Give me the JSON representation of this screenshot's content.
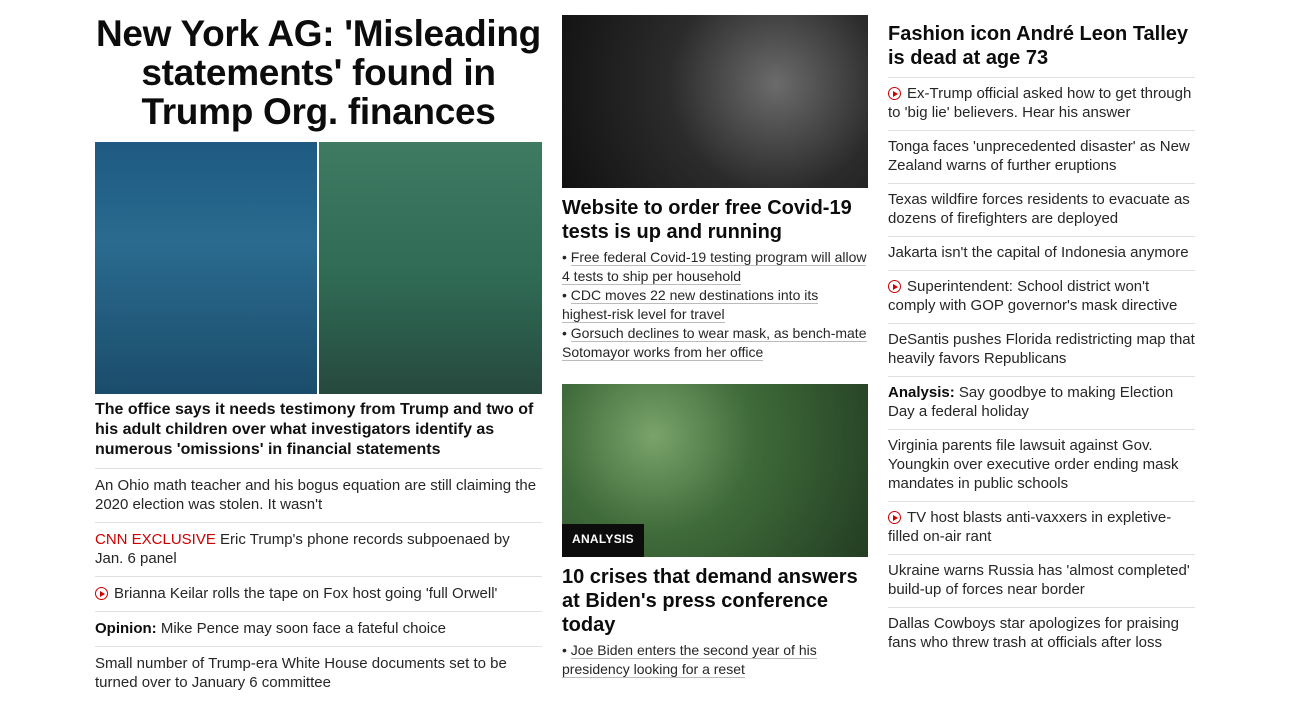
{
  "col1": {
    "headline": "New York AG: 'Misleading statements' found in Trump Org. finances",
    "description": "The office says it needs testimony from Trump and two of his adult children over what investigators identify as numerous 'omissions' in financial statements",
    "items": [
      {
        "text": "An Ohio math teacher and his bogus equation are still claiming the 2020 election was stolen. It wasn't"
      },
      {
        "prefix": "CNN EXCLUSIVE",
        "text": "Eric Trump's phone records subpoenaed by Jan. 6 panel"
      },
      {
        "text": "Brianna Keilar rolls the tape on Fox host going 'full Orwell'"
      },
      {
        "bold": "Opinion:",
        "text": "Mike Pence may soon face a fateful choice"
      },
      {
        "text": "Small number of Trump-era White House documents set to be turned over to January 6 committee"
      }
    ]
  },
  "col2": {
    "covid_headline": "Website to order free Covid-19 tests is up and running",
    "covid_bullets": [
      "Free federal Covid-19 testing program will allow 4 tests to ship per household",
      "CDC moves 22 new destinations into its highest-risk level for travel",
      "Gorsuch declines to wear mask, as bench-mate Sotomayor works from her office"
    ],
    "analysis_tag": "ANALYSIS",
    "biden_headline": "10 crises that demand answers at Biden's press conference today",
    "biden_bullets": [
      "Joe Biden enters the second year of his presidency looking for a reset"
    ]
  },
  "col3": {
    "headline": "Fashion icon André Leon Talley is dead at age 73",
    "items": [
      {
        "text": "Ex-Trump official asked how to get through to 'big lie' believers. Hear his answer"
      },
      {
        "text": "Tonga faces 'unprecedented disaster' as New Zealand warns of further eruptions"
      },
      {
        "text": "Texas wildfire forces residents to evacuate as dozens of firefighters are deployed"
      },
      {
        "text": "Jakarta isn't the capital of Indonesia anymore"
      },
      {
        "text": "Superintendent: School district won't comply with GOP governor's mask directive"
      },
      {
        "text": "DeSantis pushes Florida redistricting map that heavily favors Republicans"
      },
      {
        "bold": "Analysis:",
        "text": "Say goodbye to making Election Day a federal holiday"
      },
      {
        "text": "Virginia parents file lawsuit against Gov. Youngkin over executive order ending mask mandates in public schools"
      },
      {
        "text": "TV host blasts anti-vaxxers in expletive-filled on-air rant"
      },
      {
        "text": "Ukraine warns Russia has 'almost completed' build-up of forces near border"
      },
      {
        "text": "Dallas Cowboys star apologizes for praising fans who threw trash at officials after loss"
      }
    ]
  },
  "colors": {
    "accent_red": "#cc0000",
    "text": "#262626"
  }
}
